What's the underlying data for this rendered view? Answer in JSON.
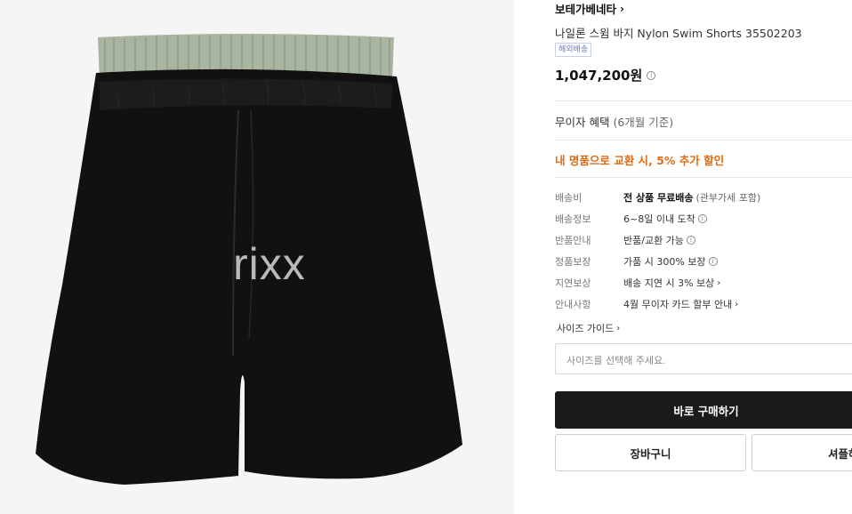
{
  "product": {
    "brand": "보테가베네타",
    "title": "나일론 스윔 바지 Nylon Swim Shorts 35502203",
    "badge": "해외배송",
    "price": "1,047,200원",
    "watermark": "rixx"
  },
  "benefit": {
    "label": "무이자 혜택",
    "sub": "(6개월 기준)"
  },
  "promo": "내 명품으로 교환 시, 5% 추가 할인",
  "specs": [
    {
      "label": "배송비",
      "value_bold": "전 상품 무료배송",
      "value_sub": "(관부가세 포함)"
    },
    {
      "label": "배송정보",
      "value": "6~8일 이내 도착"
    },
    {
      "label": "반품안내",
      "value": "반품/교환 가능"
    },
    {
      "label": "정품보장",
      "value": "가품 시 300% 보장"
    },
    {
      "label": "지연보상",
      "value": "배송 지연 시 3% 보상"
    },
    {
      "label": "안내사항",
      "value": "4월 무이자 카드 할부 안내"
    }
  ],
  "size": {
    "guide_label": "사이즈 가이드",
    "placeholder": "사이즈를 선택해 주세요."
  },
  "actions": {
    "buy": "바로 구매하기",
    "cart": "장바구니",
    "showroom": "셔플하"
  },
  "colors": {
    "accent": "#e06b14",
    "button_dark": "#1a1a1a"
  }
}
